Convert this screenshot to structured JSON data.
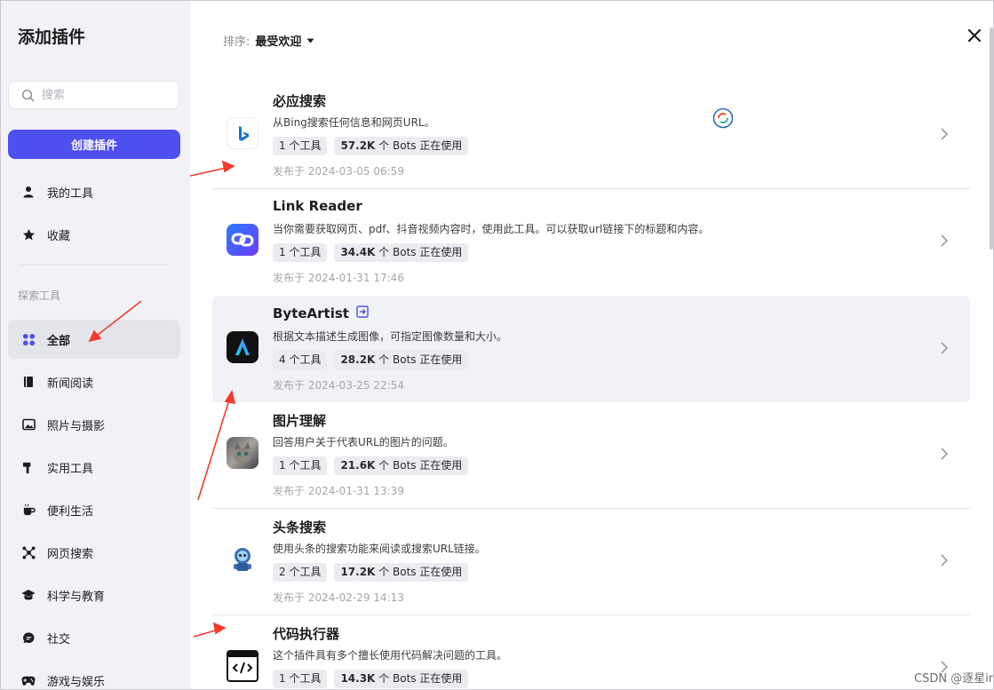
{
  "sidebar": {
    "title": "添加插件",
    "search_placeholder": "搜索",
    "create_label": "创建插件",
    "items_top": [
      {
        "label": "我的工具",
        "icon": "person-icon"
      },
      {
        "label": "收藏",
        "icon": "star-icon"
      }
    ],
    "section_label": "探索工具",
    "categories": [
      {
        "label": "全部",
        "icon": "grid-icon",
        "active": true
      },
      {
        "label": "新闻阅读",
        "icon": "book-icon"
      },
      {
        "label": "照片与摄影",
        "icon": "image-icon"
      },
      {
        "label": "实用工具",
        "icon": "hammer-icon"
      },
      {
        "label": "便利生活",
        "icon": "cup-icon"
      },
      {
        "label": "网页搜索",
        "icon": "network-icon"
      },
      {
        "label": "科学与教育",
        "icon": "graduation-cap-icon"
      },
      {
        "label": "社交",
        "icon": "chat-icon"
      },
      {
        "label": "游戏与娱乐",
        "icon": "gamepad-icon"
      }
    ]
  },
  "main": {
    "sort_label": "排序:",
    "sort_value": "最受欢迎",
    "plugins": [
      {
        "name": "必应搜索",
        "desc": "从Bing搜索任何信息和网页URL。",
        "tools": "1 个工具",
        "bots_count": "57.2K",
        "bots_suffix": " 个 Bots 正在使用",
        "date": "发布于 2024-03-05 06:59",
        "icon": "bing-icon"
      },
      {
        "name": "Link Reader",
        "desc": "当你需要获取网页、pdf、抖音视频内容时，使用此工具。可以获取url链接下的标题和内容。",
        "tools": "1 个工具",
        "bots_count": "34.4K",
        "bots_suffix": " 个 Bots 正在使用",
        "date": "发布于 2024-01-31 17:46",
        "icon": "link-icon"
      },
      {
        "name": "ByteArtist",
        "desc": "根据文本描述生成图像，可指定图像数量和大小。",
        "tools": "4 个工具",
        "bots_count": "28.2K",
        "bots_suffix": " 个 Bots 正在使用",
        "date": "发布于 2024-03-25 22:54",
        "icon": "byteartist-icon",
        "hover": true
      },
      {
        "name": "图片理解",
        "desc": "回答用户关于代表URL的图片的问题。",
        "tools": "1 个工具",
        "bots_count": "21.6K",
        "bots_suffix": " 个 Bots 正在使用",
        "date": "发布于 2024-01-31 13:39",
        "icon": "cat-photo-icon"
      },
      {
        "name": "头条搜索",
        "desc": "使用头条的搜索功能来阅读或搜索URL链接。",
        "tools": "2 个工具",
        "bots_count": "17.2K",
        "bots_suffix": " 个 Bots 正在使用",
        "date": "发布于 2024-02-29 14:13",
        "icon": "robot-icon"
      },
      {
        "name": "代码执行器",
        "desc": "这个插件具有多个擅长使用代码解决问题的工具。",
        "tools": "1 个工具",
        "bots_count": "14.3K",
        "bots_suffix": " 个 Bots 正在使用",
        "date": "",
        "icon": "code-icon"
      }
    ]
  },
  "watermark": "CSDN @逐星ing",
  "colors": {
    "accent": "#4e4fef",
    "sidebar_bg": "#f1f2f5",
    "arrow": "#f23a2e"
  }
}
